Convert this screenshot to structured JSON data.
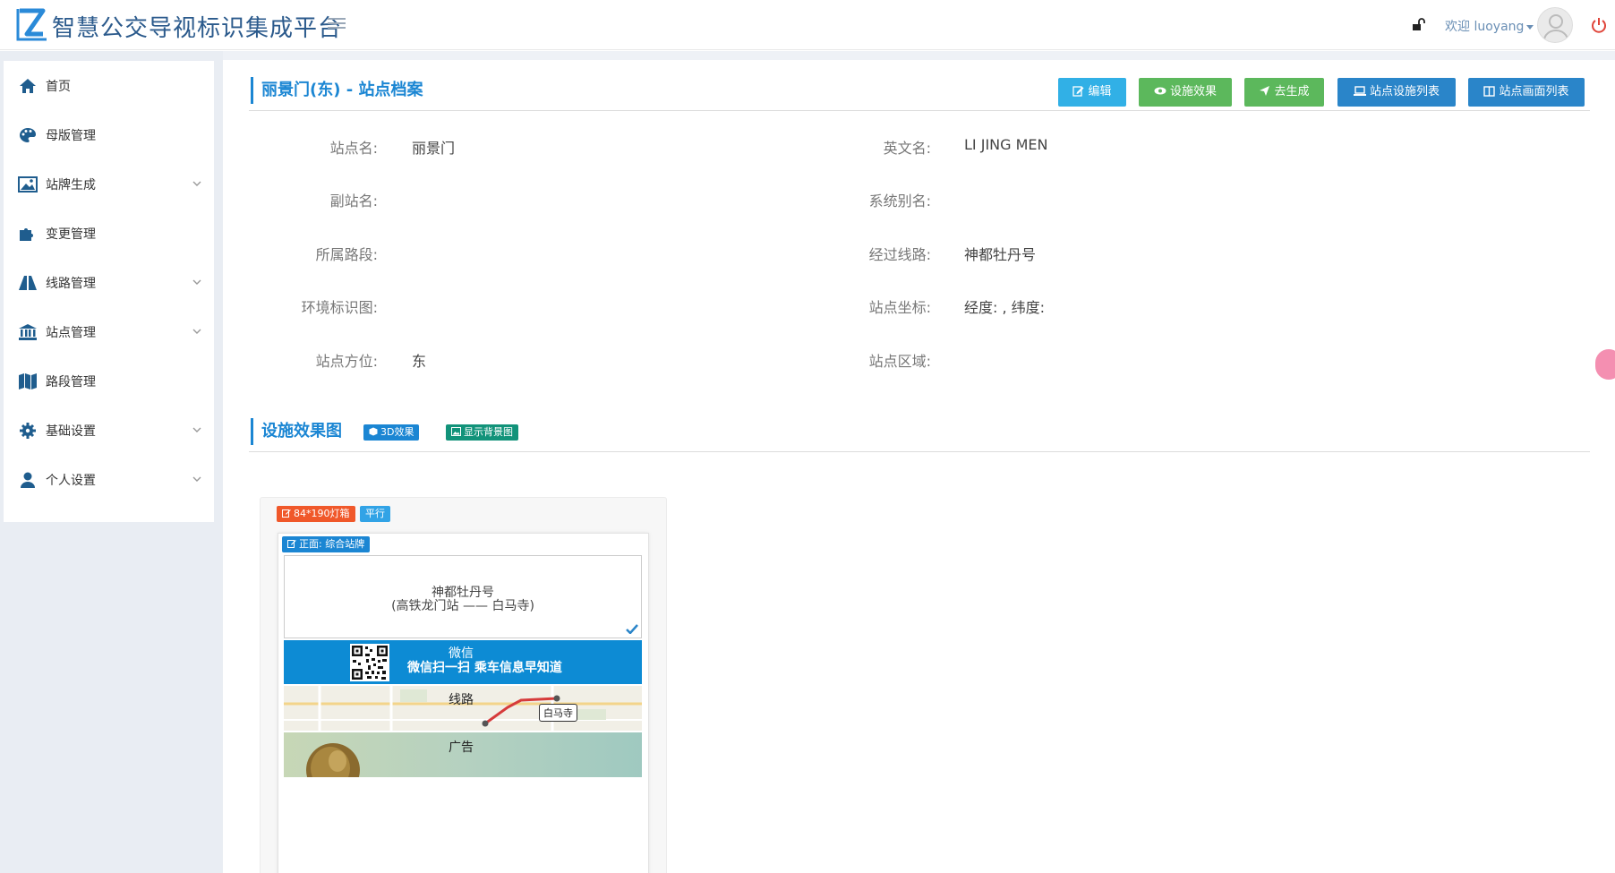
{
  "header": {
    "app_title": "智慧公交导视标识集成平台",
    "welcome": "欢迎 luoyang"
  },
  "sidebar": {
    "items": [
      {
        "label": "首页",
        "icon": "home-icon",
        "expandable": false
      },
      {
        "label": "母版管理",
        "icon": "palette-icon",
        "expandable": false
      },
      {
        "label": "站牌生成",
        "icon": "image-icon",
        "expandable": true
      },
      {
        "label": "变更管理",
        "icon": "puzzle-icon",
        "expandable": false
      },
      {
        "label": "线路管理",
        "icon": "road-icon",
        "expandable": true
      },
      {
        "label": "站点管理",
        "icon": "bank-icon",
        "expandable": true
      },
      {
        "label": "路段管理",
        "icon": "map-icon",
        "expandable": false
      },
      {
        "label": "基础设置",
        "icon": "gear-icon",
        "expandable": true
      },
      {
        "label": "个人设置",
        "icon": "user-icon",
        "expandable": true
      }
    ]
  },
  "page": {
    "title": "丽景门(东) - 站点档案",
    "buttons": {
      "edit": "编辑",
      "effect": "设施效果",
      "generate": "去生成",
      "facility_list": "站点设施列表",
      "screen_list": "站点画面列表"
    },
    "colors": {
      "cyan": "#31b0e6",
      "green": "#5cb85c",
      "blue": "#2a85c9",
      "accent": "#1b86d3"
    }
  },
  "fields": {
    "station_name": {
      "label": "站点名:",
      "value": "丽景门"
    },
    "english_name": {
      "label": "英文名:",
      "value": "LI JING MEN"
    },
    "sub_name": {
      "label": "副站名:",
      "value": ""
    },
    "system_alias": {
      "label": "系统别名:",
      "value": ""
    },
    "road_section": {
      "label": "所属路段:",
      "value": ""
    },
    "passing_lines": {
      "label": "经过线路:",
      "value": "神都牡丹号"
    },
    "env_map": {
      "label": "环境标识图:",
      "value": ""
    },
    "coordinates": {
      "label": "站点坐标:",
      "value": "经度: , 纬度:"
    },
    "direction": {
      "label": "站点方位:",
      "value": "东"
    },
    "area": {
      "label": "站点区域:",
      "value": ""
    }
  },
  "facility": {
    "title": "设施效果图",
    "tag_3d": "3D效果",
    "tag_bg": "显示背景图",
    "device_tag": "84*190灯箱",
    "orientation_tag": "平行",
    "face_tag": "正面: 综合站牌",
    "board": {
      "line_name": "神都牡丹号",
      "line_route": "(高铁龙门站 —— 白马寺)",
      "wechat_label": "微信",
      "wechat_slogan": "微信扫一扫  乘车信息早知道",
      "route_label": "线路",
      "map_stop_label": "白马寺",
      "ad_label": "广告"
    }
  }
}
